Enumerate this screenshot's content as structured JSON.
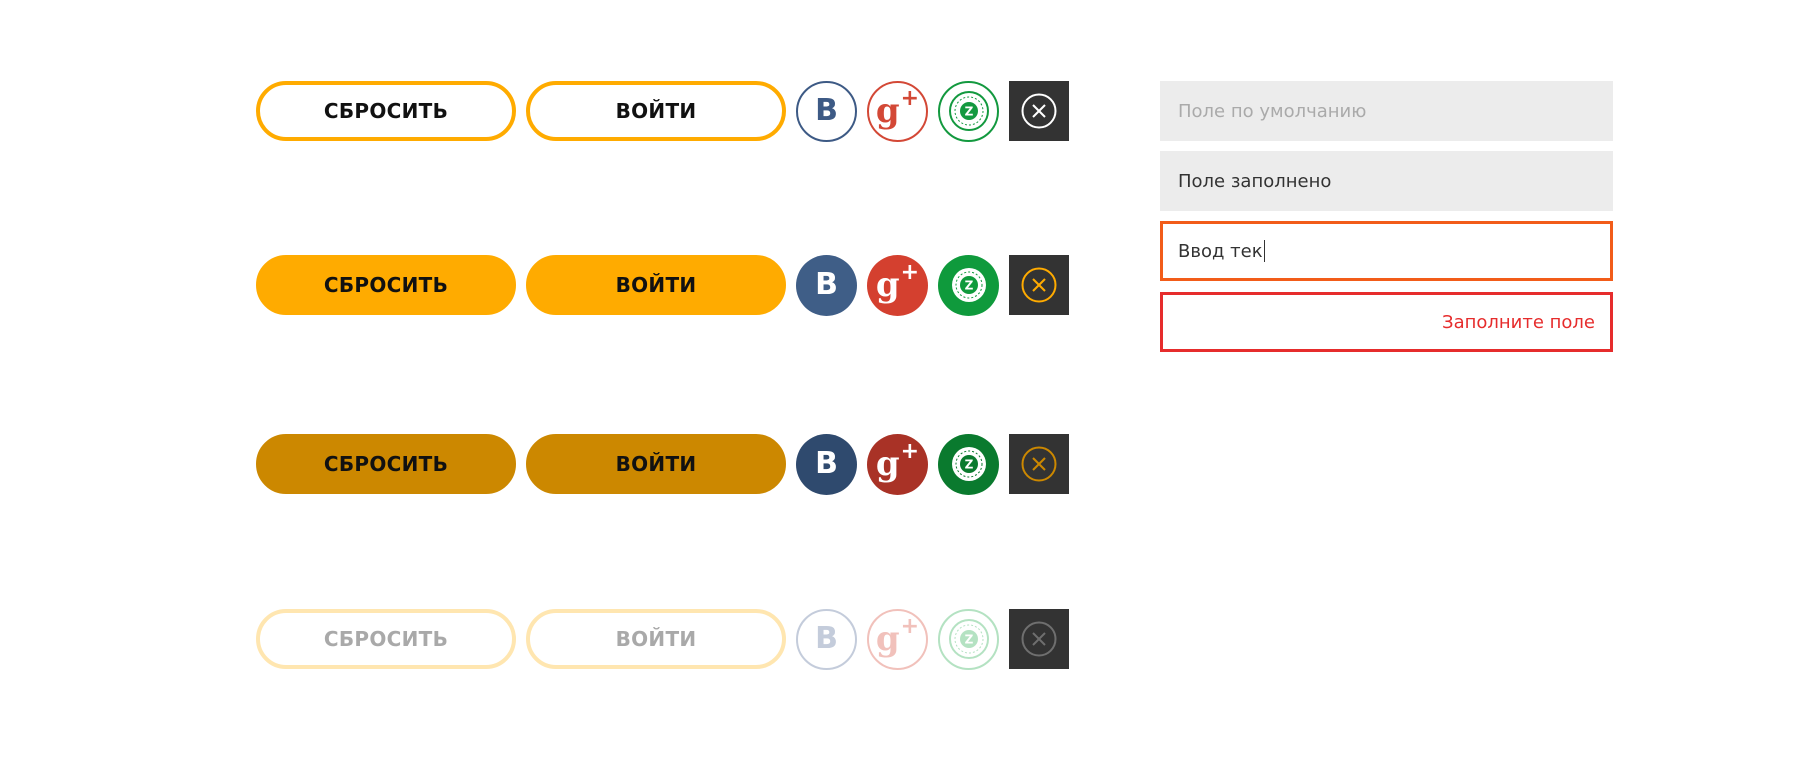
{
  "buttons": {
    "reset_label": "СБРОСИТЬ",
    "login_label": "ВОЙТИ"
  },
  "social": {
    "vk_letter": "B",
    "gplus_letter": "g",
    "gplus_plus": "+",
    "zp_letter": "Z"
  },
  "states": [
    "normal",
    "hover",
    "pressed",
    "disabled"
  ],
  "fields": {
    "default_placeholder": "Поле по умолчанию",
    "filled_value": "Поле заполнено",
    "typing_value": "Ввод тек",
    "error_message": "Заполните поле"
  },
  "colors": {
    "accent": "#ffab00",
    "accent_pressed": "#cc8800",
    "vk": "#3f5e87",
    "gplus": "#d4402f",
    "zp": "#0f9a3c",
    "close_bg": "#333333",
    "focus_border": "#f25c19",
    "error": "#e62c2c"
  }
}
